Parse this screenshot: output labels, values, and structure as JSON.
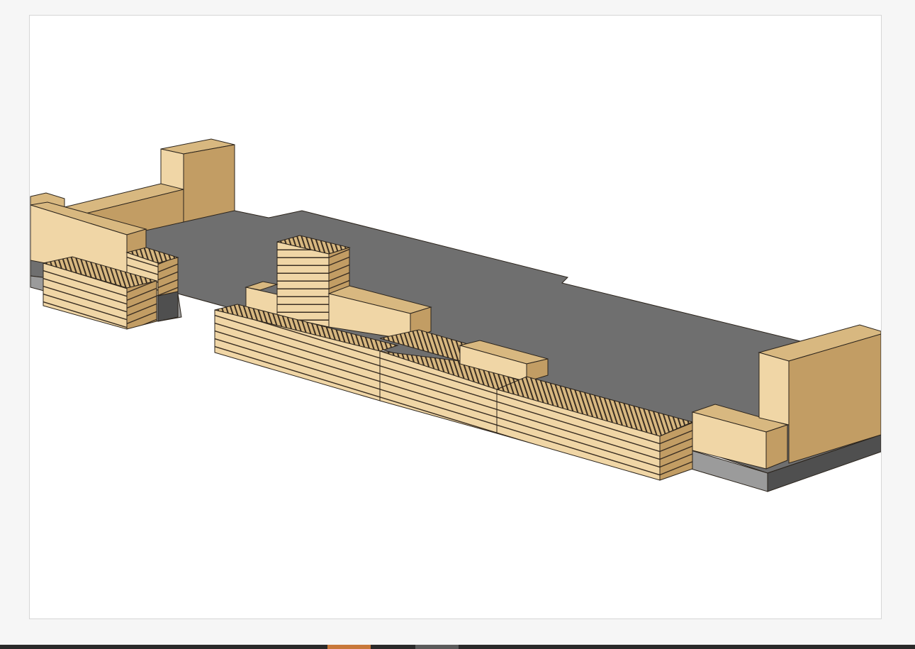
{
  "viewer": {
    "model": "3d-massing-model",
    "colors": {
      "ground_top": "#6f6f6f",
      "ground_side": "#9b9b9b",
      "ground_shadow": "#4a4a4a",
      "timber_top": "#d8b880",
      "timber_front": "#f0d6a6",
      "timber_side": "#c29d64",
      "clt_stripe": "#3a2e22",
      "outline": "#2b241c"
    }
  },
  "taskbar": {
    "colors": {
      "background": "#2a2a2a",
      "active_item": "#c8783a",
      "inactive_item": "#5b5b5b"
    }
  }
}
